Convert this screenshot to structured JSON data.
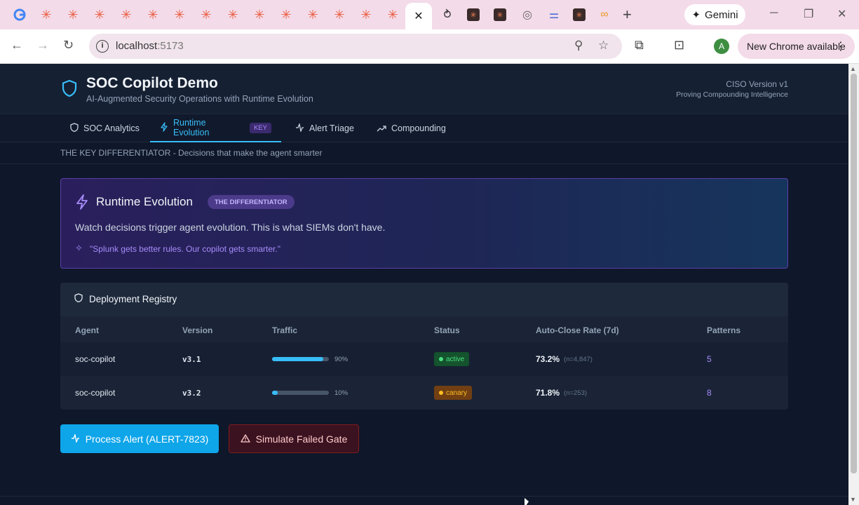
{
  "browser": {
    "url_host": "localhost",
    "url_port": ":5173",
    "gemini_label": "Gemini",
    "update_label": "New Chrome available",
    "profile_initial": "A"
  },
  "app": {
    "title": "SOC Copilot Demo",
    "subtitle": "AI-Augmented Security Operations with Runtime Evolution",
    "version_label": "CISO Version v1",
    "version_sub": "Proving Compounding Intelligence"
  },
  "nav": {
    "tabs": [
      {
        "label": "SOC Analytics",
        "icon": "shield-icon"
      },
      {
        "label": "Runtime Evolution",
        "icon": "lightning-icon",
        "badge": "KEY",
        "active": true
      },
      {
        "label": "Alert Triage",
        "icon": "activity-icon"
      },
      {
        "label": "Compounding",
        "icon": "trending-up-icon"
      }
    ]
  },
  "subbar": {
    "text": "THE KEY DIFFERENTIATOR - Decisions that make the agent smarter"
  },
  "hero": {
    "title": "Runtime Evolution",
    "badge": "THE DIFFERENTIATOR",
    "description": "Watch decisions trigger agent evolution. This is what SIEMs don't have.",
    "quote": "\"Splunk gets better rules. Our copilot gets smarter.\""
  },
  "registry": {
    "title": "Deployment Registry",
    "columns": [
      "Agent",
      "Version",
      "Traffic",
      "Status",
      "Auto-Close Rate (7d)",
      "Patterns"
    ],
    "rows": [
      {
        "agent": "soc-copilot",
        "version": "v3.1",
        "traffic_pct": 90,
        "traffic_label": "90%",
        "status": "active",
        "rate": "73.2%",
        "n": "(n=4,847)",
        "patterns": "5"
      },
      {
        "agent": "soc-copilot",
        "version": "v3.2",
        "traffic_pct": 10,
        "traffic_label": "10%",
        "status": "canary",
        "rate": "71.8%",
        "n": "(n=253)",
        "patterns": "8"
      }
    ]
  },
  "actions": {
    "process_label": "Process Alert (ALERT-7823)",
    "fail_label": "Simulate Failed Gate"
  },
  "colors": {
    "accent": "#38bdf8",
    "purple": "#a78bfa",
    "active_status": "#4ade80",
    "canary_status": "#fbbf24"
  }
}
